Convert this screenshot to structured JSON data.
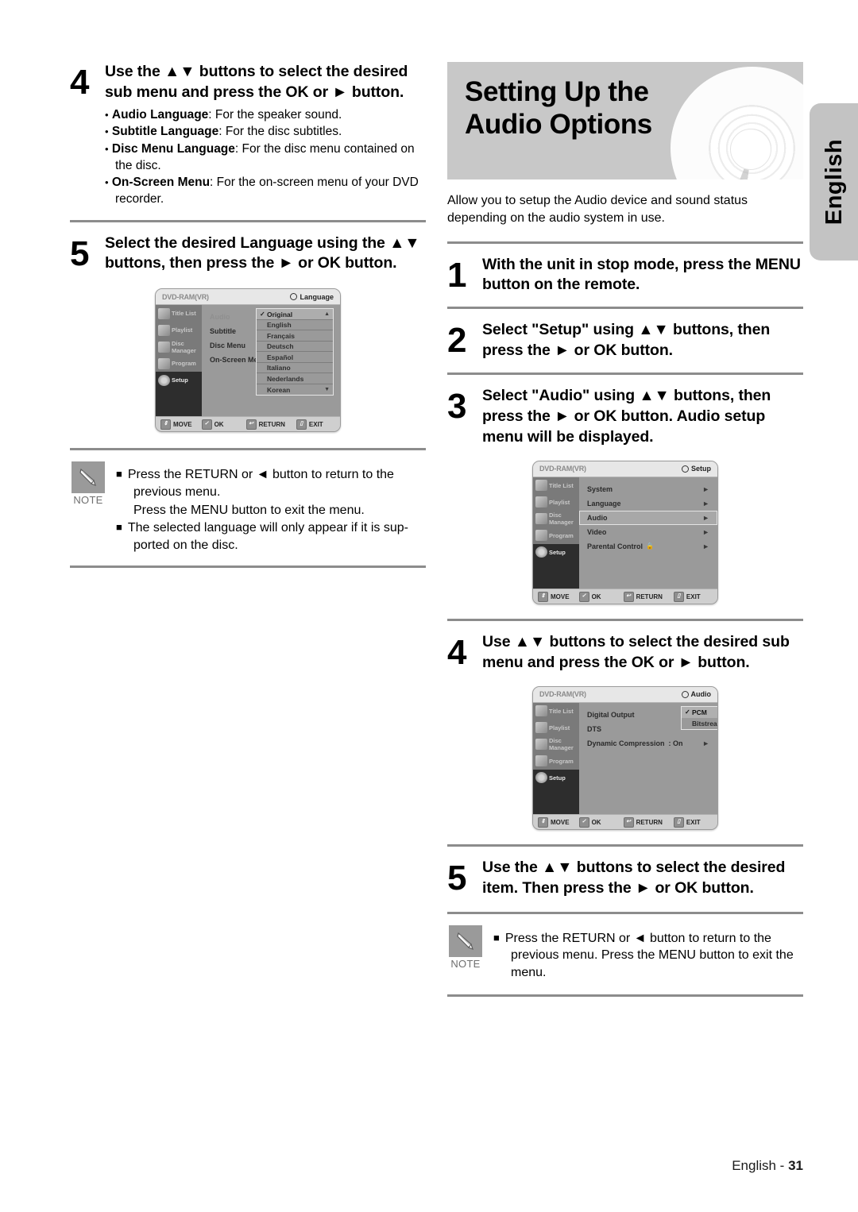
{
  "side_tab": {
    "label": "English"
  },
  "footer": {
    "language": "English -",
    "page": "31"
  },
  "left_column": {
    "step4": {
      "num": "4",
      "title": "Use the ▲▼ buttons to select the desired sub menu and press the OK or ► button.",
      "bullets": [
        {
          "term": "Audio Language",
          "desc": ": For the speaker sound."
        },
        {
          "term": "Subtitle Language",
          "desc": ": For the disc subtitles."
        },
        {
          "term": "Disc Menu Language",
          "desc": ": For the disc menu contained on the disc."
        },
        {
          "term": "On-Screen Menu",
          "desc": ": For the on-screen menu of your DVD recorder."
        }
      ]
    },
    "step5": {
      "num": "5",
      "title": "Select the desired Language using the ▲▼ buttons, then press the ► or OK button."
    },
    "language_osd": {
      "disc": "DVD-RAM(VR)",
      "mode": "Language",
      "sidebar": [
        {
          "label": "Title List",
          "selected": false
        },
        {
          "label": "Playlist",
          "selected": false
        },
        {
          "label": "Disc Manager",
          "selected": false
        },
        {
          "label": "Program",
          "selected": false
        },
        {
          "label": "Setup",
          "selected": true
        }
      ],
      "rows": [
        {
          "label": "Audio",
          "dim": true
        },
        {
          "label": "Subtitle",
          "dim": false
        },
        {
          "label": "Disc Menu",
          "dim": false
        },
        {
          "label": "On-Screen Menu",
          "dim": false
        }
      ],
      "languages": [
        {
          "label": "Original",
          "checked": true,
          "selected": true,
          "caret": "▲"
        },
        {
          "label": "English",
          "checked": false,
          "selected": false,
          "caret": ""
        },
        {
          "label": "Français",
          "checked": false,
          "selected": false,
          "caret": ""
        },
        {
          "label": "Deutsch",
          "checked": false,
          "selected": false,
          "caret": ""
        },
        {
          "label": "Español",
          "checked": false,
          "selected": false,
          "caret": ""
        },
        {
          "label": "Italiano",
          "checked": false,
          "selected": false,
          "caret": ""
        },
        {
          "label": "Nederlands",
          "checked": false,
          "selected": false,
          "caret": ""
        },
        {
          "label": "Korean",
          "checked": false,
          "selected": false,
          "caret": "▼"
        }
      ],
      "bar": [
        {
          "icon": "updown-icon",
          "label": "MOVE"
        },
        {
          "icon": "ok-icon",
          "label": "OK"
        },
        {
          "icon": "return-icon",
          "label": "RETURN"
        },
        {
          "icon": "exit-icon",
          "label": "EXIT"
        }
      ]
    },
    "note": {
      "label": "NOTE",
      "lines": [
        {
          "bullet": true,
          "text": "Press the RETURN or ◄ button to return to the previous menu."
        },
        {
          "bullet": false,
          "text": "Press the MENU button to exit the menu."
        },
        {
          "bullet": true,
          "text": "The selected language will only appear if it is sup-ported on the disc."
        }
      ]
    }
  },
  "right_column": {
    "banner": {
      "title": "Setting Up the Audio Options",
      "intro": "Allow you to setup the Audio device and sound status depending on the audio system in use."
    },
    "step1": {
      "num": "1",
      "title": "With the unit in stop mode, press the MENU button on the remote."
    },
    "step2": {
      "num": "2",
      "title": "Select \"Setup\" using ▲▼ buttons, then press the ► or OK button."
    },
    "step3": {
      "num": "3",
      "title": "Select \"Audio\" using ▲▼ buttons, then press the ► or OK button. Audio setup menu will be displayed."
    },
    "setup_osd": {
      "disc": "DVD-RAM(VR)",
      "mode": "Setup",
      "sidebar": [
        {
          "label": "Title List",
          "selected": false
        },
        {
          "label": "Playlist",
          "selected": false
        },
        {
          "label": "Disc Manager",
          "selected": false
        },
        {
          "label": "Program",
          "selected": false
        },
        {
          "label": "Setup",
          "selected": true
        }
      ],
      "rows": [
        {
          "label": "System",
          "selected": false,
          "arrow": "►"
        },
        {
          "label": "Language",
          "selected": false,
          "arrow": "►"
        },
        {
          "label": "Audio",
          "selected": true,
          "arrow": "►"
        },
        {
          "label": "Video",
          "selected": false,
          "arrow": "►"
        },
        {
          "label": "Parental Control",
          "selected": false,
          "arrow": "►",
          "lock": true
        }
      ],
      "bar": [
        {
          "icon": "updown-icon",
          "label": "MOVE"
        },
        {
          "icon": "ok-icon",
          "label": "OK"
        },
        {
          "icon": "return-icon",
          "label": "RETURN"
        },
        {
          "icon": "exit-icon",
          "label": "EXIT"
        }
      ]
    },
    "step4": {
      "num": "4",
      "title": "Use ▲▼ buttons to select the desired sub menu and press the OK or ► button."
    },
    "audio_osd": {
      "disc": "DVD-RAM(VR)",
      "mode": "Audio",
      "sidebar": [
        {
          "label": "Title List",
          "selected": false
        },
        {
          "label": "Playlist",
          "selected": false
        },
        {
          "label": "Disc Manager",
          "selected": false
        },
        {
          "label": "Program",
          "selected": false
        },
        {
          "label": "Setup",
          "selected": true
        }
      ],
      "rows": [
        {
          "label": "Digital Output",
          "value": "",
          "arrow": ""
        },
        {
          "label": "DTS",
          "value": "",
          "arrow": ""
        },
        {
          "label": "Dynamic Compression",
          "value": ": On",
          "arrow": "►"
        }
      ],
      "values": [
        {
          "label": "PCM",
          "checked": true,
          "selected": true
        },
        {
          "label": "Bitstream",
          "checked": false,
          "selected": false
        }
      ],
      "bar": [
        {
          "icon": "updown-icon",
          "label": "MOVE"
        },
        {
          "icon": "ok-icon",
          "label": "OK"
        },
        {
          "icon": "return-icon",
          "label": "RETURN"
        },
        {
          "icon": "exit-icon",
          "label": "EXIT"
        }
      ]
    },
    "step5": {
      "num": "5",
      "title": "Use the ▲▼ buttons to select the desired item. Then press the ► or OK button."
    },
    "note": {
      "label": "NOTE",
      "lines": [
        {
          "bullet": true,
          "text": "Press the RETURN or ◄ button to return to the previous menu. Press the MENU button to exit the menu."
        }
      ]
    }
  }
}
